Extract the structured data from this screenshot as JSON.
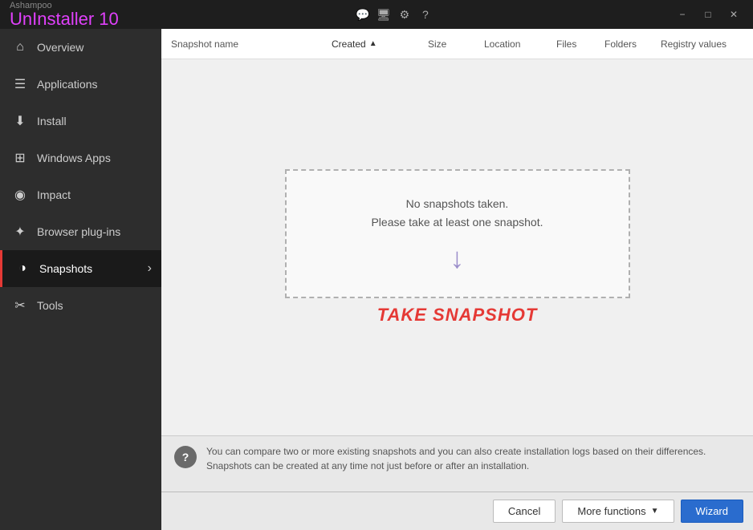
{
  "app": {
    "brand": "Ashampoo",
    "title_prefix": "Un",
    "title_main": "Installer 10",
    "version": "10"
  },
  "titlebar": {
    "icons": [
      "chat-icon",
      "monitor-icon",
      "gear-icon",
      "help-icon"
    ],
    "controls": [
      "minimize",
      "maximize",
      "close"
    ]
  },
  "sidebar": {
    "items": [
      {
        "id": "overview",
        "label": "Overview",
        "icon": "⌂",
        "active": false
      },
      {
        "id": "applications",
        "label": "Applications",
        "icon": "☰",
        "active": false
      },
      {
        "id": "install",
        "label": "Install",
        "icon": "⬇",
        "active": false
      },
      {
        "id": "windows-apps",
        "label": "Windows Apps",
        "icon": "⊞",
        "active": false
      },
      {
        "id": "impact",
        "label": "Impact",
        "icon": "◉",
        "active": false
      },
      {
        "id": "browser-plugins",
        "label": "Browser plug-ins",
        "icon": "✦",
        "active": false
      },
      {
        "id": "snapshots",
        "label": "Snapshots",
        "icon": "◑",
        "active": true
      },
      {
        "id": "tools",
        "label": "Tools",
        "icon": "✂",
        "active": false
      }
    ]
  },
  "table": {
    "columns": [
      {
        "id": "snapshot-name",
        "label": "Snapshot name",
        "sortable": false
      },
      {
        "id": "created",
        "label": "Created",
        "sortable": true,
        "sort_dir": "asc"
      },
      {
        "id": "size",
        "label": "Size",
        "sortable": false
      },
      {
        "id": "location",
        "label": "Location",
        "sortable": false
      },
      {
        "id": "files",
        "label": "Files",
        "sortable": false
      },
      {
        "id": "folders",
        "label": "Folders",
        "sortable": false
      },
      {
        "id": "registry-values",
        "label": "Registry values",
        "sortable": false
      }
    ]
  },
  "empty_state": {
    "line1": "No snapshots taken.",
    "line2": "Please take at least one snapshot.",
    "cta": "TAKE SNAPSHOT"
  },
  "info_bar": {
    "text": "You can compare two or more existing snapshots and you can also create installation logs based on their differences. Snapshots can be created at any time not just before or after an installation."
  },
  "footer": {
    "cancel_label": "Cancel",
    "more_label": "More functions",
    "wizard_label": "Wizard"
  }
}
